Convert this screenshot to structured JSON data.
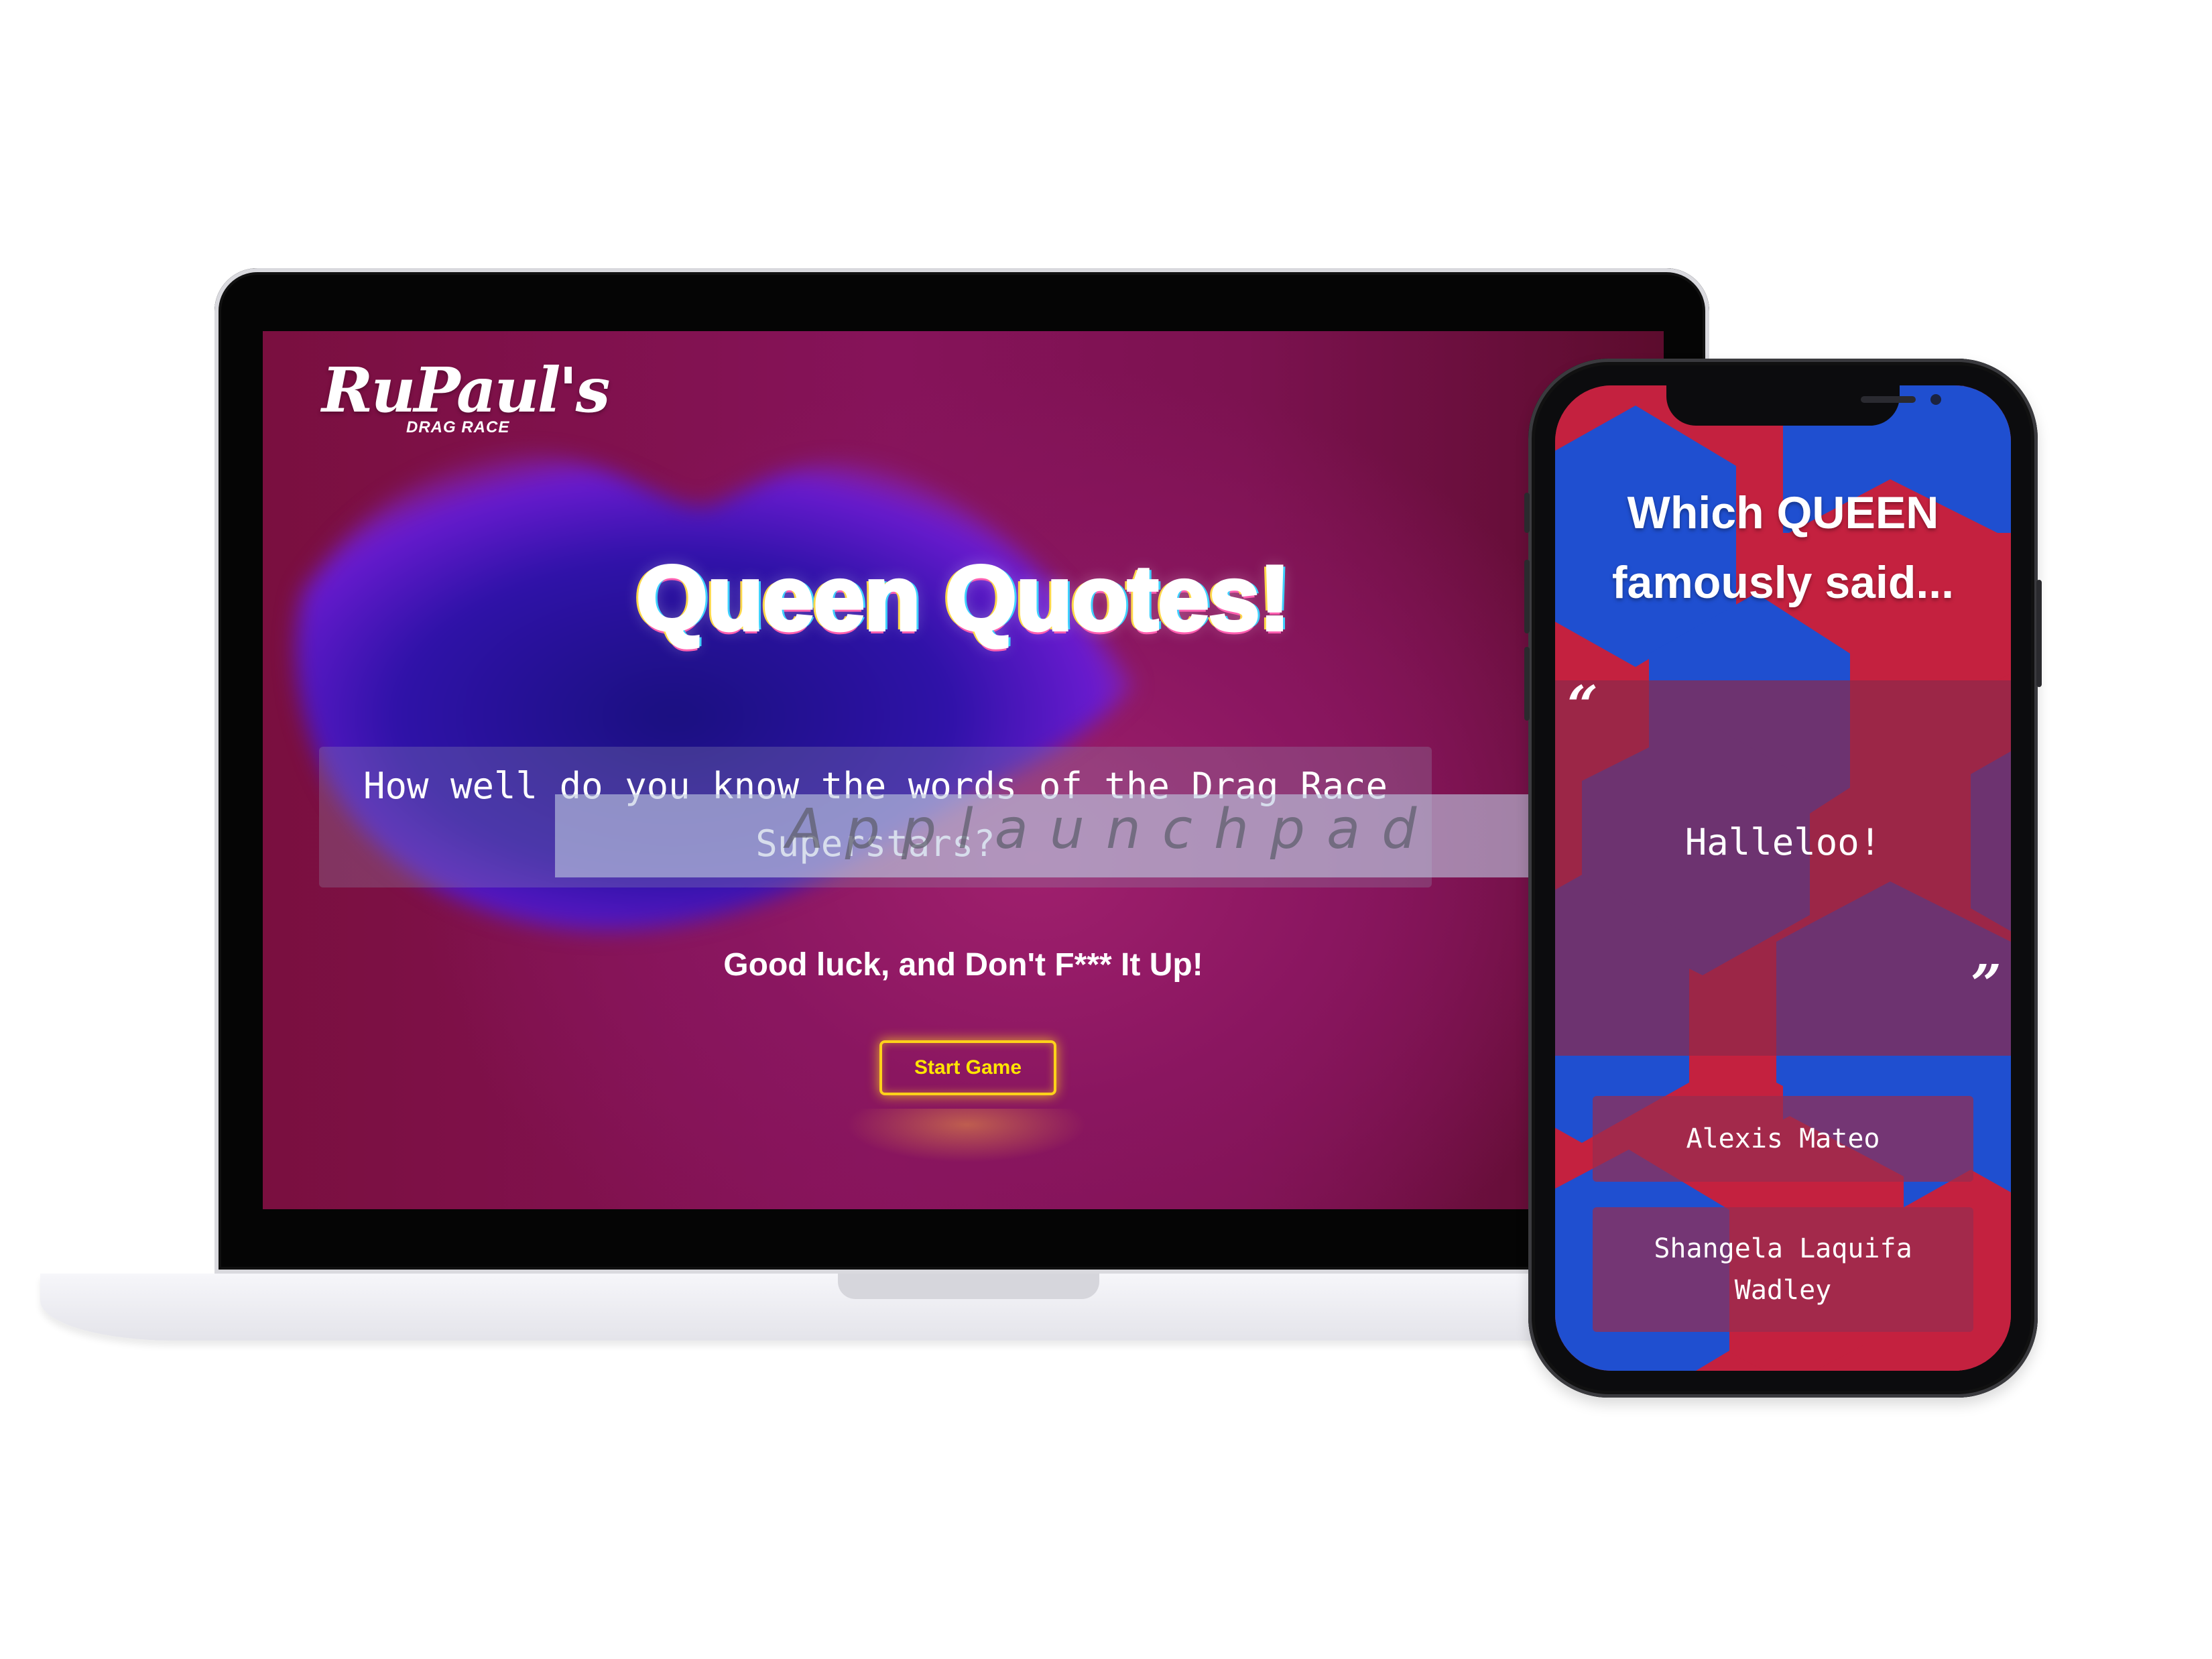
{
  "laptop_app": {
    "logo": {
      "main": "RuPaul's",
      "sub": "DRAG RACE"
    },
    "title": "Queen Quotes!",
    "subtitle": "How well do you know the words of the Drag Race Superstars?",
    "tagline": "Good luck, and Don't F*** It Up!",
    "start_button": "Start Game"
  },
  "watermark": "Applaunchpad",
  "phone_app": {
    "question": "Which QUEEN famously said...",
    "quote_open_mark": "“",
    "quote": "Halleloo!",
    "quote_close_mark": "”",
    "answers": [
      "Alexis Mateo",
      "Shangela Laquifa Wadley"
    ]
  },
  "colors": {
    "accent": "#ffd21a",
    "laptop_bg": "#86135a",
    "phone_red": "#c4213f",
    "phone_blue": "#1f4fd0"
  }
}
